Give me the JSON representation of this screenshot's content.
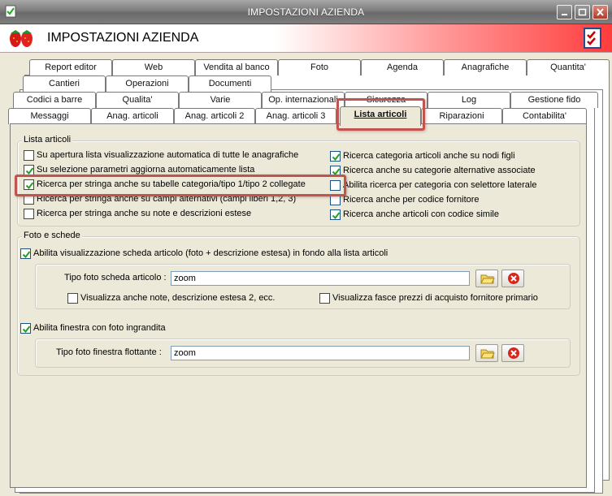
{
  "window": {
    "title": "IMPOSTAZIONI AZIENDA",
    "header_title": "IMPOSTAZIONI AZIENDA",
    "icons": [
      "app-icon",
      "strawberry-logo",
      "checklist-icon",
      "minimize-icon",
      "maximize-icon",
      "close-icon"
    ]
  },
  "tabs": {
    "row1": [
      "Report editor",
      "Web",
      "Vendita al banco",
      "Foto",
      "Agenda",
      "Anagrafiche",
      "Quantita'"
    ],
    "row2": [
      "Cantieri",
      "Operazioni",
      "Documenti"
    ],
    "row3": [
      "Codici a barre",
      "Qualita'",
      "Varie",
      "Op. internazionali",
      "Sicurezza",
      "Log",
      "Gestione fido"
    ],
    "row4": [
      "Messaggi",
      "Anag. articoli",
      "Anag. articoli 2",
      "Anag. articoli 3",
      "Lista articoli",
      "Riparazioni",
      "Contabilita'"
    ],
    "active": "Lista articoli"
  },
  "lista_articoli": {
    "title": "Lista articoli",
    "left_options": [
      {
        "label": "Su apertura lista visualizzazione automatica di tutte le anagrafiche",
        "checked": false
      },
      {
        "label": "Su selezione parametri aggiorna automaticamente lista",
        "checked": true
      },
      {
        "label": "Ricerca per stringa anche su tabelle categoria/tipo 1/tipo 2 collegate",
        "checked": true
      },
      {
        "label": "Ricerca per stringa anche su campi alternativi (campi liberi 1,2, 3)",
        "checked": false
      },
      {
        "label": "Ricerca per stringa anche su note e descrizioni estese",
        "checked": false
      }
    ],
    "right_options": [
      {
        "label": "Ricerca categoria articoli anche su nodi figli",
        "checked": true
      },
      {
        "label": "Ricerca anche su categorie alternative associate",
        "checked": true
      },
      {
        "label": "Abilita ricerca per categoria con selettore laterale",
        "checked": false
      },
      {
        "label": "Ricerca anche per codice fornitore",
        "checked": false
      },
      {
        "label": "Ricerca anche articoli con codice simile",
        "checked": true
      }
    ]
  },
  "foto_schede": {
    "title": "Foto e schede",
    "enable_scheda": {
      "label": "Abilita visualizzazione scheda articolo (foto + descrizione estesa) in fondo alla lista articoli",
      "checked": true
    },
    "tipo_foto_scheda": {
      "label": "Tipo foto scheda articolo :",
      "value": "zoom"
    },
    "visualizza_note": {
      "label": "Visualizza anche note, descrizione estesa 2, ecc.",
      "checked": false
    },
    "visualizza_fasce": {
      "label": "Visualizza fasce prezzi di acquisto fornitore primario",
      "checked": false
    },
    "enable_finestra": {
      "label": "Abilita finestra con foto ingrandita",
      "checked": true
    },
    "tipo_foto_finestra": {
      "label": "Tipo foto finestra flottante :",
      "value": "zoom"
    }
  },
  "colors": {
    "highlight": "#c0554f",
    "header_gradient_end": "#ff3c3c"
  }
}
